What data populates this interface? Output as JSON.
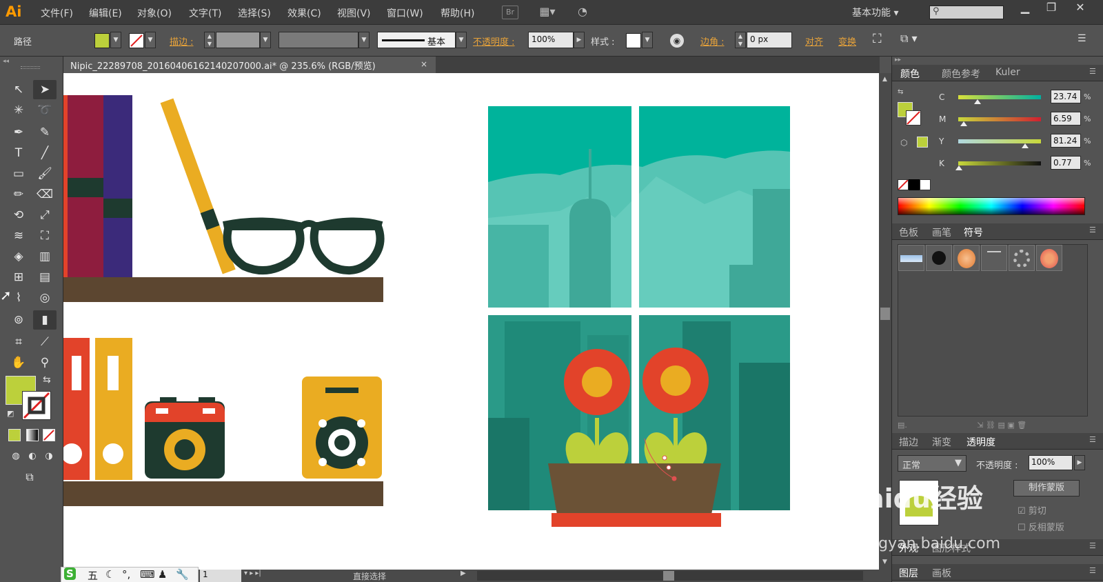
{
  "app": {
    "logo": "Ai"
  },
  "menu": [
    "文件(F)",
    "编辑(E)",
    "对象(O)",
    "文字(T)",
    "选择(S)",
    "效果(C)",
    "视图(V)",
    "窗口(W)",
    "帮助(H)"
  ],
  "menubar_icons": {
    "bridge": "Br"
  },
  "workspace": "基本功能",
  "control_bar": {
    "selection_type": "路径",
    "stroke_label": "描边 :",
    "stroke_profile": "基本",
    "opacity_label": "不透明度 :",
    "opacity_value": "100%",
    "style_label": "样式 :",
    "corner_label": "边角 :",
    "corner_value": "0 px",
    "align_label": "对齐",
    "transform_label": "变换"
  },
  "document": {
    "tab_title": "Nipic_22289708_20160406162140207000.ai* @ 235.6% (RGB/预览)",
    "close": "×"
  },
  "status": {
    "zoom_page": "1",
    "tool_name": "直接选择"
  },
  "color_panel": {
    "tabs": [
      "颜色",
      "颜色参考",
      "Kuler"
    ],
    "sliders": [
      {
        "label": "C",
        "value": "23.74",
        "fraction": 0.2374
      },
      {
        "label": "M",
        "value": "6.59",
        "fraction": 0.0659
      },
      {
        "label": "Y",
        "value": "81.24",
        "fraction": 0.8124
      },
      {
        "label": "K",
        "value": "0.77",
        "fraction": 0.0077
      }
    ],
    "unit": "%"
  },
  "symbols_panel": {
    "tabs": [
      "色板",
      "画笔",
      "符号"
    ]
  },
  "transparency_panel": {
    "tabs": [
      "描边",
      "渐变",
      "透明度"
    ],
    "blend_mode": "正常",
    "opacity_label": "不透明度 :",
    "opacity_value": "100%",
    "make_mask": "制作蒙版",
    "clip": "剪切",
    "invert_mask": "反相蒙版"
  },
  "bottom_panels": {
    "appearance_tabs": [
      "外观",
      "图形样式"
    ],
    "layers_tabs": [
      "图层",
      "画板"
    ]
  },
  "ime": {
    "mode": "五"
  },
  "watermark": {
    "main": "Baidu经验",
    "sub": "jingyan.baidu.com"
  },
  "colors": {
    "fill": "#bcd03b",
    "accent": "#e8a33a",
    "teal": "#00b39b",
    "flower": "#e2432a"
  }
}
